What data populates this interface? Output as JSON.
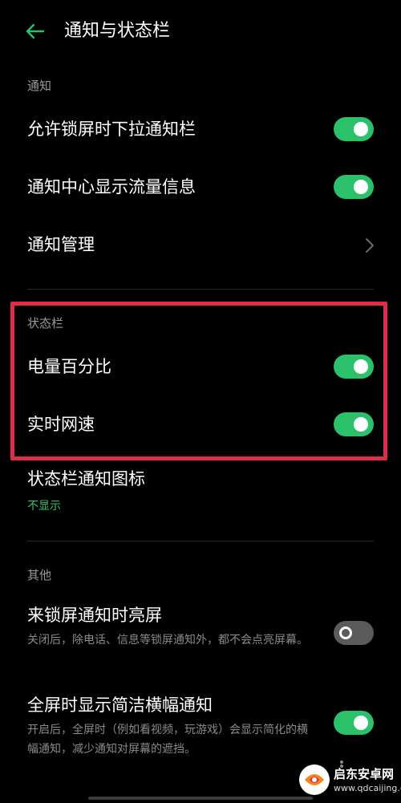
{
  "header": {
    "title": "通知与状态栏",
    "back_icon": "arrow-left-icon"
  },
  "sections": {
    "notification": {
      "label": "通知",
      "items": [
        {
          "title": "允许锁屏时下拉通知栏",
          "toggle": true
        },
        {
          "title": "通知中心显示流量信息",
          "toggle": true
        },
        {
          "title": "通知管理",
          "icon": "chevron-right-icon"
        }
      ]
    },
    "status_bar": {
      "label": "状态栏",
      "items": [
        {
          "title": "电量百分比",
          "toggle": true
        },
        {
          "title": "实时网速",
          "toggle": true
        },
        {
          "title": "状态栏通知图标",
          "value": "不显示"
        }
      ]
    },
    "other": {
      "label": "其他",
      "items": [
        {
          "title": "来锁屏通知时亮屏",
          "desc": "关闭后，除电话、信息等锁屏通知外，都不会点亮屏幕。",
          "toggle": false
        },
        {
          "title": "全屏时显示简洁横幅通知",
          "desc": "开启后，全屏时（例如看视频，玩游戏）会显示简化的横幅通知，减少通知对屏幕的遮挡。",
          "toggle": true
        }
      ]
    }
  },
  "watermark": {
    "name": "启东安卓网",
    "url": "www.qdcaijing.com"
  },
  "colors": {
    "accent": "#2bc06a",
    "highlight": "#e12b4a",
    "background": "#000000"
  }
}
